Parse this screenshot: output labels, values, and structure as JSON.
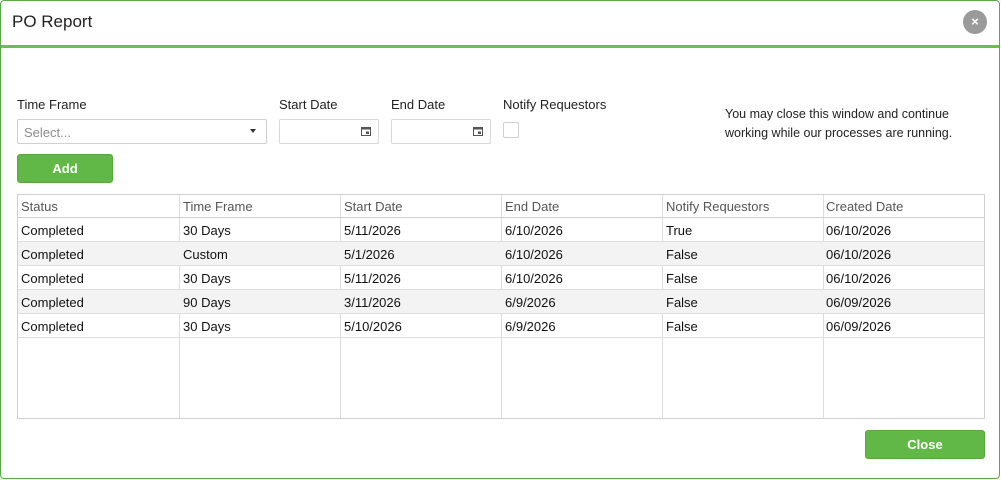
{
  "dialog": {
    "title": "PO Report",
    "close_icon": "×"
  },
  "form": {
    "time_frame_label": "Time Frame",
    "time_frame_placeholder": "Select...",
    "start_date_label": "Start Date",
    "end_date_label": "End Date",
    "notify_label": "Notify Requestors",
    "info_text": "You may close this window and continue working while our processes are running.",
    "add_label": "Add"
  },
  "grid": {
    "columns": [
      "Status",
      "Time Frame",
      "Start Date",
      "End Date",
      "Notify Requestors",
      "Created Date"
    ],
    "rows": [
      [
        "Completed",
        "30 Days",
        "5/11/2026",
        "6/10/2026",
        "True",
        "06/10/2026"
      ],
      [
        "Completed",
        "Custom",
        "5/1/2026",
        "6/10/2026",
        "False",
        "06/10/2026"
      ],
      [
        "Completed",
        "30 Days",
        "5/11/2026",
        "6/10/2026",
        "False",
        "06/10/2026"
      ],
      [
        "Completed",
        "90 Days",
        "3/11/2026",
        "6/9/2026",
        "False",
        "06/09/2026"
      ],
      [
        "Completed",
        "30 Days",
        "5/10/2026",
        "6/9/2026",
        "False",
        "06/09/2026"
      ]
    ]
  },
  "footer": {
    "close_label": "Close"
  },
  "icons": {
    "close": "close-icon",
    "dropdown": "chevron-down-icon",
    "calendar": "calendar-icon"
  },
  "colors": {
    "accent": "#62b847",
    "header_border": "#6abf4b",
    "close_icon_bg": "#9a9a9a",
    "row_alt": "#f3f3f3"
  }
}
